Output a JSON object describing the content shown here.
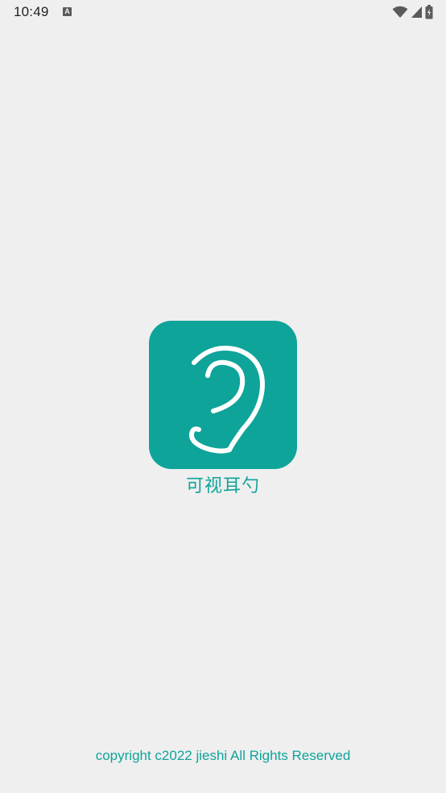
{
  "status_bar": {
    "time": "10:49",
    "notification_icon": "a-icon",
    "notification_glyph": "A",
    "icons": [
      "wifi-icon",
      "signal-icon",
      "battery-icon"
    ]
  },
  "splash": {
    "app_icon": "ear-icon",
    "app_name": "可视耳勺",
    "copyright": "copyright c2022 jieshi All Rights Reserved"
  },
  "colors": {
    "accent": "#0ea49a",
    "background": "#efefef"
  }
}
